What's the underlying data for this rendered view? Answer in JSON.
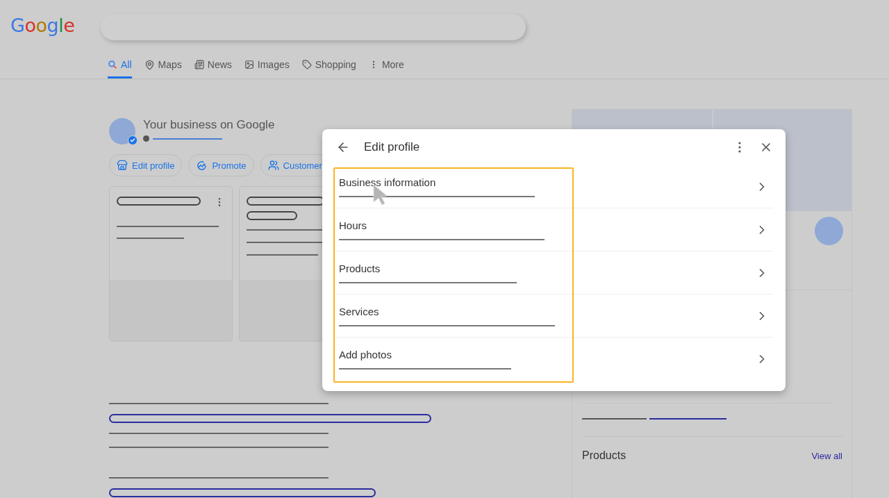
{
  "logo": "Google",
  "tabs": [
    {
      "label": "All",
      "selected": true
    },
    {
      "label": "Maps",
      "selected": false
    },
    {
      "label": "News",
      "selected": false
    },
    {
      "label": "Images",
      "selected": false
    },
    {
      "label": "Shopping",
      "selected": false
    },
    {
      "label": "More",
      "selected": false
    }
  ],
  "business": {
    "title": "Your business on Google",
    "actions": [
      "Edit profile",
      "Promote",
      "Customer"
    ]
  },
  "dialog": {
    "title": "Edit profile",
    "items": [
      "Business information",
      "Hours",
      "Products",
      "Services",
      "Add photos"
    ]
  },
  "side_panel": {
    "section_title": "Products",
    "link": "View all"
  }
}
